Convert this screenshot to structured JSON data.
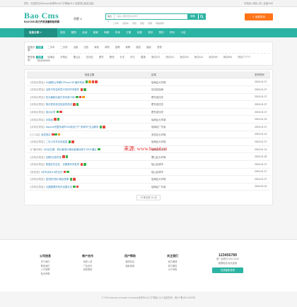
{
  "topbar": {
    "left": "您好，欢迎您访问baocms多城市o2o门户模板V6.2 [请登录] [免费注册]",
    "right": "手机版  |  商家入驻  |  百度CMS"
  },
  "header": {
    "logo_big": "Bao Cms",
    "logo_small": "BAOCMS-助力开发流量积极积累",
    "city": "合肥 ∨",
    "search_select": "信息 ∨",
    "search_placeholder": "请输入要搜索的关键词",
    "search_btn": "搜索",
    "hot": [
      "二手车",
      "出租车",
      "家政",
      "招租",
      "家教",
      "电脑维修"
    ],
    "post_btn": "免费发布"
  },
  "nav": {
    "category": "信息分类 ≡",
    "items": [
      "首页",
      "团购",
      "活动",
      "商家",
      "商城",
      "外卖",
      "订座",
      "优惠",
      "资讯",
      "预约",
      "积分",
      "小区"
    ]
  },
  "filter": {
    "rows": [
      {
        "label": "信息分类：",
        "options": [
          "全部",
          "二手车",
          "二手房",
          "出租",
          "出售",
          "家政",
          "求职",
          "招聘",
          "家教",
          "婚恋",
          "摄影",
          "宠物"
        ],
        "active": 0
      },
      {
        "label": "所在地址：",
        "options": [
          "全部",
          "瑶海区",
          "庐阳区",
          "蜀山区",
          "包河区",
          "肥东",
          "肥西",
          "长丰",
          "庐江",
          "巢湖",
          "测试222",
          "测试111",
          "测试333",
          "测试444",
          "测试555",
          "测试666",
          "测试777777",
          "测试888888"
        ],
        "active": 0
      }
    ]
  },
  "list": {
    "headers": [
      "信息主题",
      "区域",
      "发布时间"
    ],
    "rows": [
      {
        "cat": "【手机论项目】",
        "title": "3rx图转让苹果5 iPhone 5S 最好有线",
        "badges": [
          "g",
          "o",
          "r",
          "r"
        ],
        "area": "瑶海区大学城",
        "date": "2015-01-07"
      },
      {
        "cat": "【手机论项目】",
        "title": "出售汽车没有意义任何汽车配件",
        "badges": [
          "r",
          "g"
        ],
        "area": "包河区瑶海",
        "date": "2015-01-07"
      },
      {
        "cat": "【手机论项目】",
        "title": "佐为最新出版打折优惠+8折",
        "badges": [
          "g",
          "r",
          "o"
        ],
        "area": "肥东县住宅",
        "date": "2015-01-07"
      },
      {
        "cat": "【手机论项目】",
        "title": "测试发布测试信息的测试",
        "badges": [
          "r",
          "g"
        ],
        "area": "肥东县住宅",
        "date": "2015-01-07"
      },
      {
        "cat": "【手机论项目】",
        "title": "成功大学",
        "badges": [
          "g",
          "r"
        ],
        "area": "肥东县住宅",
        "date": "2015-01-07"
      },
      {
        "cat": "【手机论项目】",
        "title": "手机版",
        "badges": [
          "r",
          "g"
        ],
        "area": "瑶海区大学城",
        "date": "2015-01-23"
      },
      {
        "cat": "【手机论项目】",
        "title": "baocms完整多城市020综合门户 多城市+生活服务",
        "badges": [
          "g",
          "r"
        ],
        "area": "瑶海区广东省",
        "date": "2015-01-07"
      },
      {
        "cat": "【工人站】",
        "title": "测试测试",
        "badges": [
          "r",
          "g",
          "o"
        ],
        "area": "测试区大学城",
        "date": "2015-01-14"
      },
      {
        "cat": "【手机论项目】",
        "title": "二手小中东无线连接",
        "badges": [
          "g",
          "r"
        ],
        "area": "瑶海区大学城",
        "date": "2015-01-07"
      },
      {
        "cat": "【门面冷库】",
        "title": "100台空调，底价最低价格出租增加低于100%通过",
        "badges": [
          "g"
        ],
        "area": "瑶海区大学城",
        "date": "2015-01-14"
      },
      {
        "cat": "【手机论项目】",
        "title": "合肥5点发布信",
        "badges": [
          "r",
          "g"
        ],
        "area": "蜀山区大学城",
        "date": "2015-01-28"
      },
      {
        "cat": "【手机论项目】",
        "title": "家居区先生在，合肥爱车好处所",
        "badges": [
          "r",
          "g"
        ],
        "area": "瑶山区城市",
        "date": "2015-01-07"
      },
      {
        "cat": "【安全说】",
        "title": "3手车出手4-8的正在",
        "badges": [
          "r",
          "g"
        ],
        "area": "瑶山区城市",
        "date": "2015-01-27"
      },
      {
        "cat": "【手机论项目】",
        "title": "[宏观]不到价格及规律",
        "badges": [
          "g",
          "r"
        ],
        "area": "瑶海区大学城",
        "date": "2015-01-07"
      },
      {
        "cat": "【手机论项目】",
        "title": "大图整理东阳东全国无法",
        "badges": [
          "g",
          "r"
        ],
        "area": "瑶海区广东省",
        "date": "2015-02-02"
      }
    ],
    "pager": "15 条记录 1/1 页"
  },
  "watermark": "来源: www.haoid.cn",
  "footer": {
    "cols": [
      {
        "title": "公司信息",
        "items": [
          "关于我们",
          "联系我们",
          "人才招聘",
          "免责声明"
        ]
      },
      {
        "title": "商户合作",
        "items": [
          "商家入驻",
          "广告合作",
          "商家登录"
        ]
      },
      {
        "title": "用户帮助",
        "items": [
          "服务协议",
          "隐私条款"
        ]
      },
      {
        "title": "关注我们",
        "items": [
          "官方微博",
          "官方微信",
          "公众号码"
        ]
      }
    ],
    "tel": "123456789",
    "hours": "周一至周日 9:00-22:00",
    "note": "客服电话 免长途费",
    "kf_btn": "在线客服/咨询",
    "copyright": "© 2015 baocms.cn haoid.cn baocms多城市o2o门户模板 V6.2 版权所有 - 皖ICP备05014003号"
  }
}
